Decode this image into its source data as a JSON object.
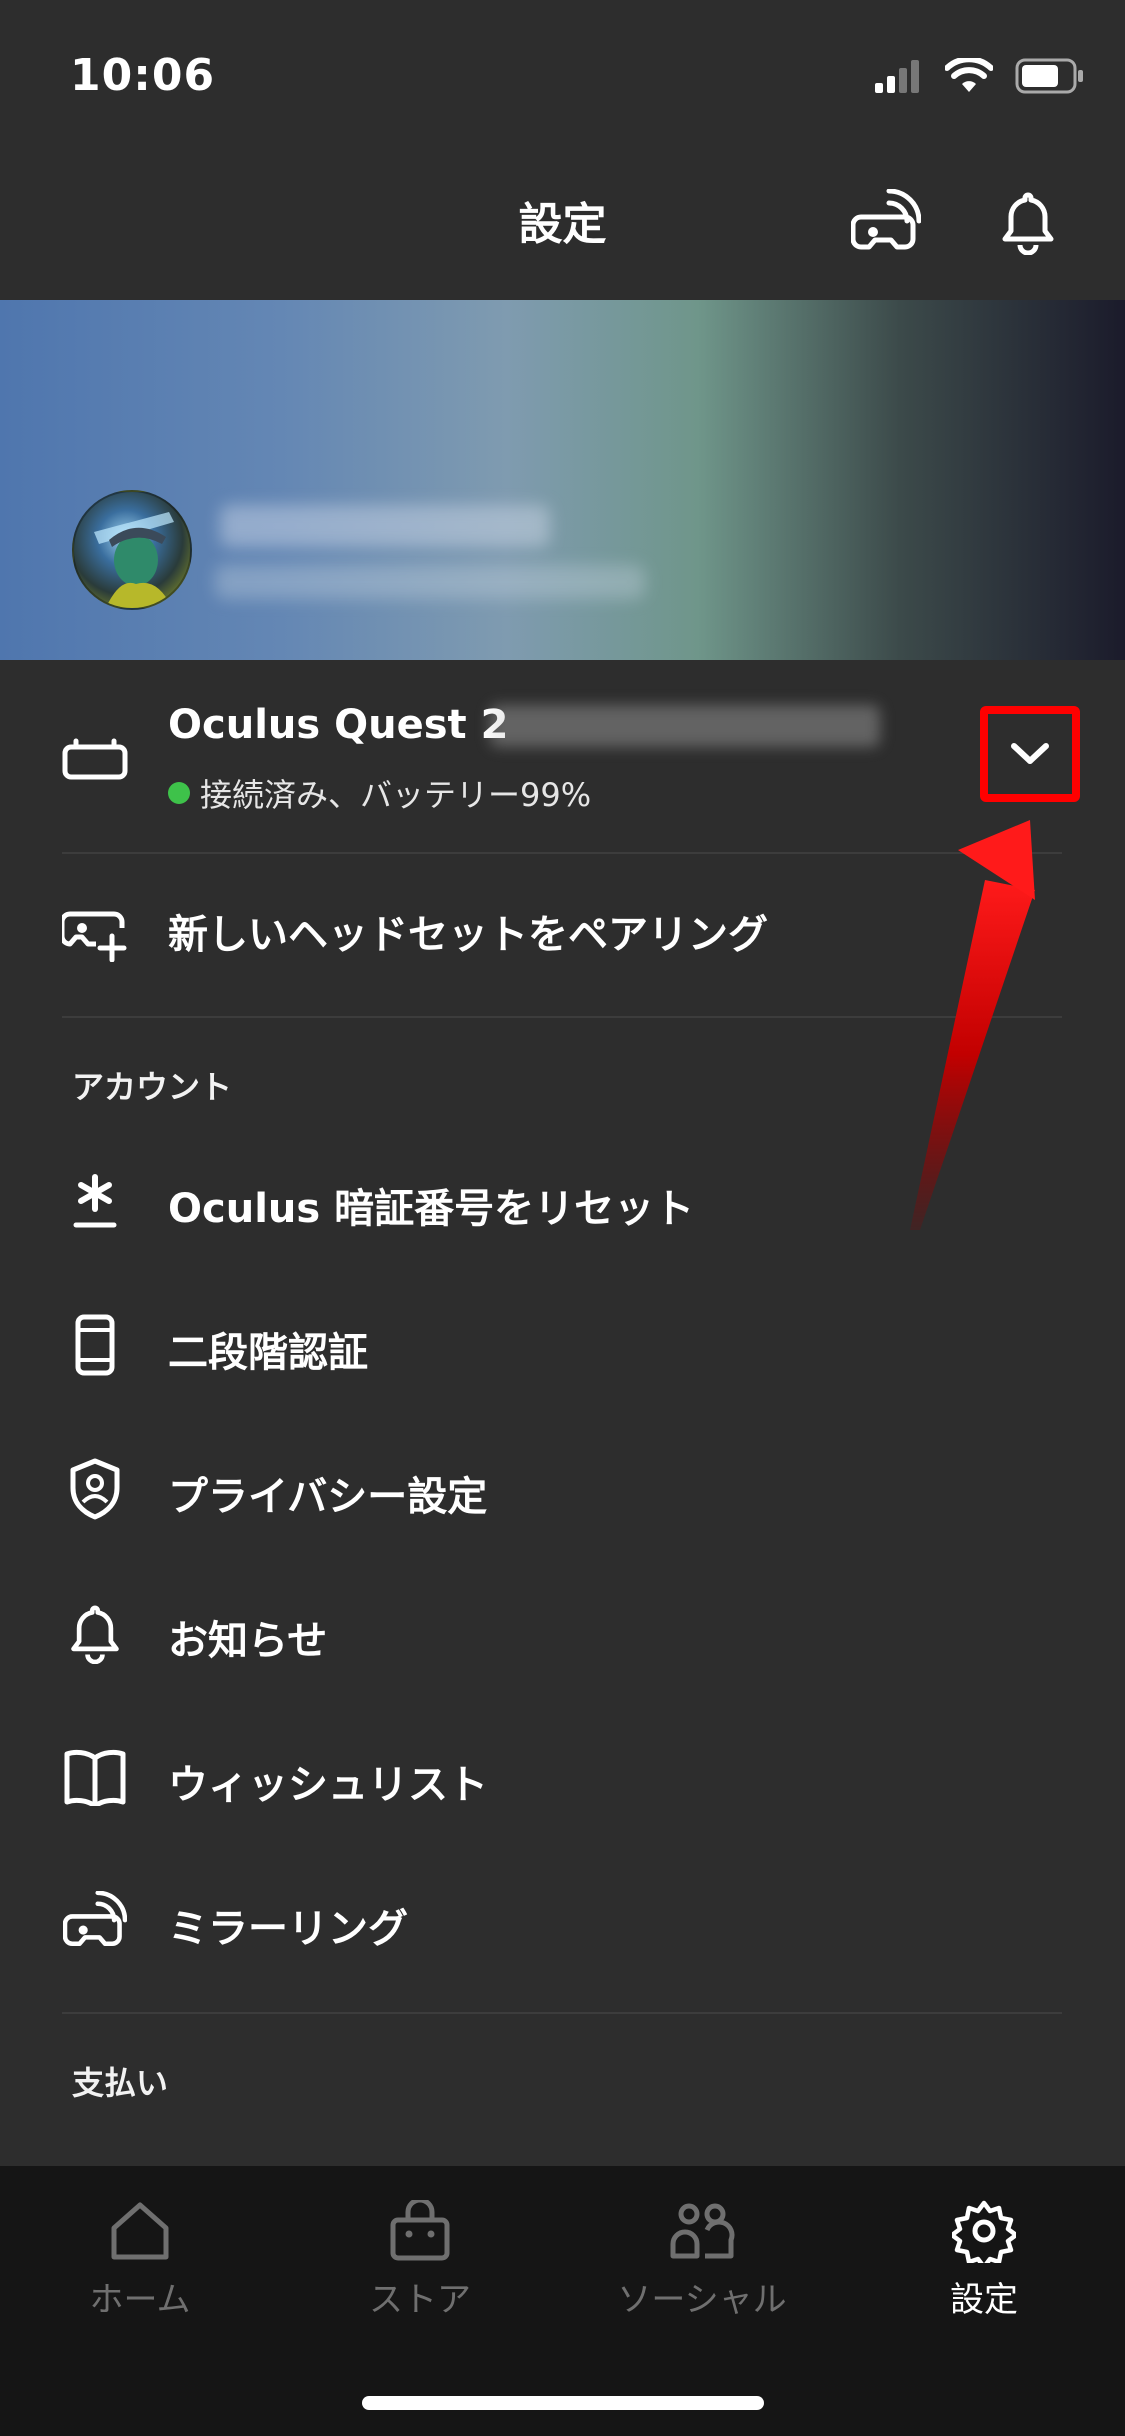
{
  "status_bar": {
    "time": "10:06"
  },
  "header": {
    "title": "設定"
  },
  "device": {
    "name": "Oculus Quest 2",
    "status": "接続済み、バッテリー99%",
    "battery_percent": 99,
    "status_color": "#3ec24a"
  },
  "pair": {
    "label": "新しいヘッドセットをペアリング"
  },
  "account": {
    "section_title": "アカウント",
    "items": [
      {
        "label": "Oculus 暗証番号をリセット",
        "icon": "asterisk-icon"
      },
      {
        "label": "二段階認証",
        "icon": "phone-icon"
      },
      {
        "label": "プライバシー設定",
        "icon": "shield-user-icon"
      },
      {
        "label": "お知らせ",
        "icon": "bell-icon"
      },
      {
        "label": "ウィッシュリスト",
        "icon": "book-icon"
      },
      {
        "label": "ミラーリング",
        "icon": "cast-headset-icon"
      }
    ]
  },
  "payment": {
    "section_title": "支払い"
  },
  "tabs": [
    {
      "label": "ホーム",
      "icon": "home-icon",
      "active": false
    },
    {
      "label": "ストア",
      "icon": "store-bag-icon",
      "active": false
    },
    {
      "label": "ソーシャル",
      "icon": "people-icon",
      "active": false
    },
    {
      "label": "設定",
      "icon": "gear-icon",
      "active": true
    }
  ],
  "colors": {
    "background": "#2d2d2d",
    "tab_bar": "#151515",
    "highlight": "#ff0000",
    "annotation_arrow": "#d90000"
  }
}
